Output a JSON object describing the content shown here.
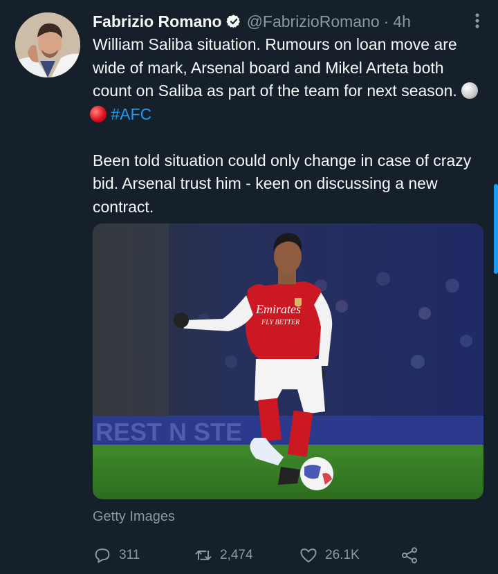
{
  "tweet": {
    "author_name": "Fabrizio Romano",
    "handle": "@FabrizioRomano",
    "separator": "·",
    "time": "4h",
    "para1": "William Saliba situation. Rumours on loan move are wide of mark, Arsenal board and Mikel Arteta both count on Saliba as part of the team for next season. ",
    "hashtag": "#AFC",
    "para2": "Been told situation could only change in case of crazy bid. Arsenal trust him - keen on discussing a new contract.",
    "media_credit": "Getty Images",
    "shirt_sponsor_line1": "Emirates",
    "shirt_sponsor_line2": "FLY BETTER",
    "stadium_board": "REST     N    STE"
  },
  "actions": {
    "replies": "311",
    "retweets": "2,474",
    "likes": "26.1K"
  },
  "colors": {
    "background": "#15202b",
    "accent": "#1d9bf0",
    "muted": "#8b98a5",
    "text": "#f7f9f9"
  },
  "icons": [
    "verified-badge-icon",
    "more-options-icon",
    "reply-icon",
    "retweet-icon",
    "like-icon",
    "share-icon"
  ]
}
